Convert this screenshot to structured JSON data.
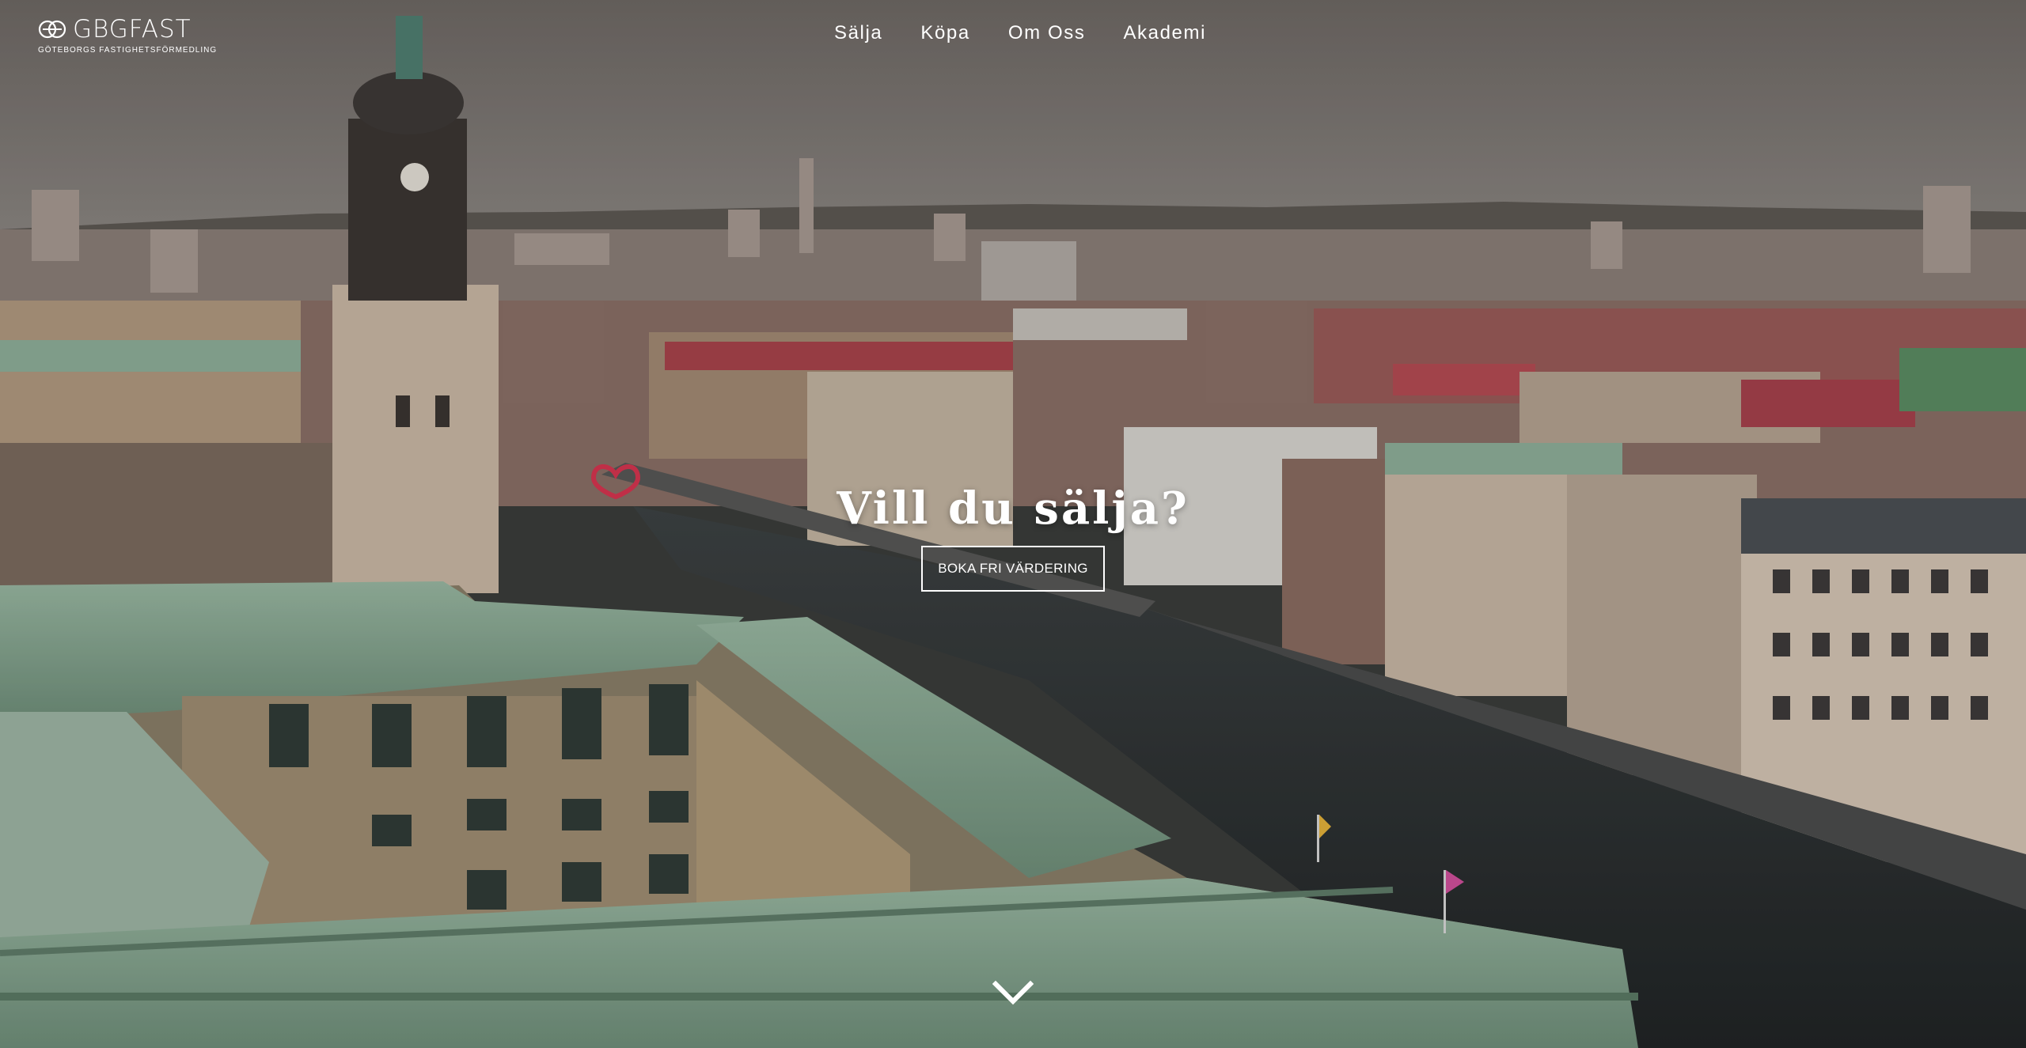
{
  "brand": {
    "name": "GBGFAST",
    "tagline": "GÖTEBORGS FASTIGHETSFÖRMEDLING"
  },
  "nav": {
    "items": [
      {
        "label": "Sälja"
      },
      {
        "label": "Köpa"
      },
      {
        "label": "Om Oss"
      },
      {
        "label": "Akademi"
      }
    ]
  },
  "hero": {
    "headline": "Vill du sälja?",
    "cta_label": "BOKA FRI VÄRDERING",
    "background": "aerial-city-river-photo"
  },
  "icons": {
    "logo": "gbgfast-logo-icon",
    "scroll": "chevron-down-icon"
  },
  "colors": {
    "text": "#ffffff",
    "sky": "#7a7572",
    "roof_green": "#8fae97",
    "river": "#2a2e30"
  }
}
